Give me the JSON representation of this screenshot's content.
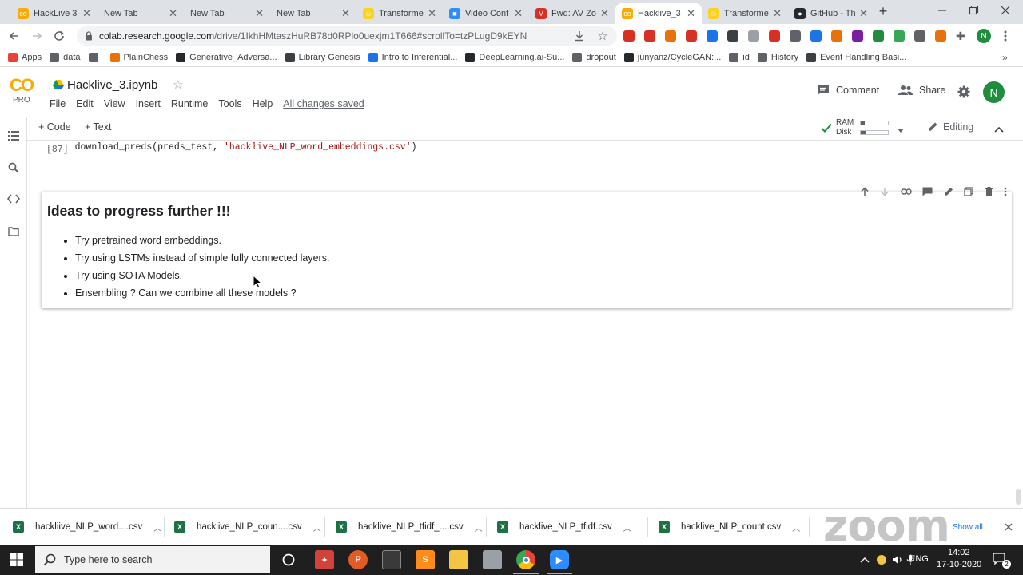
{
  "browser": {
    "tabs": [
      {
        "title": "HackLive 3",
        "fav_color": "#f9ab00",
        "fav_glyph": "co",
        "active": false
      },
      {
        "title": "New Tab",
        "fav_color": "",
        "fav_glyph": "",
        "active": false
      },
      {
        "title": "New Tab",
        "fav_color": "",
        "fav_glyph": "",
        "active": false
      },
      {
        "title": "New Tab",
        "fav_color": "",
        "fav_glyph": "",
        "active": false
      },
      {
        "title": "Transforme",
        "fav_color": "#ffd21e",
        "fav_glyph": "☺",
        "active": false
      },
      {
        "title": "Video Conf",
        "fav_color": "#2d8cff",
        "fav_glyph": "■",
        "active": false
      },
      {
        "title": "Fwd: AV Zo",
        "fav_color": "#d93025",
        "fav_glyph": "M",
        "active": false
      },
      {
        "title": "Hacklive_3",
        "fav_color": "#f9ab00",
        "fav_glyph": "co",
        "active": true
      },
      {
        "title": "Transforme",
        "fav_color": "#ffd21e",
        "fav_glyph": "☺",
        "active": false
      },
      {
        "title": "GitHub - Th",
        "fav_color": "#24292e",
        "fav_glyph": "●",
        "active": false
      }
    ],
    "url_host": "colab.research.google.com",
    "url_path": "/drive/1IkhHMtaszHuRB78d0RPlo0uexjm1T666#scrollTo=tzPLugD9kEYN",
    "extension_avatar": "N",
    "bookmarks": [
      {
        "label": "Apps",
        "color": "#ea4335"
      },
      {
        "label": "data",
        "color": "#5f6368"
      },
      {
        "label": "",
        "color": "#5f6368"
      },
      {
        "label": "PlainChess",
        "color": "#e8710a"
      },
      {
        "label": "Generative_Adversa...",
        "color": "#24292e"
      },
      {
        "label": "Library Genesis",
        "color": "#3c4043"
      },
      {
        "label": "Intro to Inferential...",
        "color": "#1a73e8"
      },
      {
        "label": "DeepLearning.ai-Su...",
        "color": "#24292e"
      },
      {
        "label": "dropout",
        "color": "#5f6368"
      },
      {
        "label": "junyanz/CycleGAN:...",
        "color": "#24292e"
      },
      {
        "label": "id",
        "color": "#5f6368"
      },
      {
        "label": "History",
        "color": "#5f6368"
      },
      {
        "label": "Event Handling Basi...",
        "color": "#3c4043"
      }
    ]
  },
  "colab": {
    "logo_text": "CO",
    "logo_sub": "PRO",
    "notebook_title": "Hacklive_3.ipynb",
    "menu": [
      "File",
      "Edit",
      "View",
      "Insert",
      "Runtime",
      "Tools",
      "Help"
    ],
    "saved_status": "All changes saved",
    "comment_label": "Comment",
    "share_label": "Share",
    "user_avatar": "N",
    "add_code_label": "+ Code",
    "add_text_label": "+ Text",
    "ram_label": "RAM",
    "disk_label": "Disk",
    "editing_label": "Editing"
  },
  "code_cell": {
    "exec_count": "[87]",
    "code_prefix": "download_preds(preds_test, ",
    "code_string": "'hacklive_NLP_word_embeddings.csv'",
    "code_suffix": ")"
  },
  "markdown_cell": {
    "heading": "Ideas to progress further !!!",
    "bullets": [
      "Try pretrained word embeddings.",
      "Try using LSTMs instead of simple fully connected layers.",
      "Try using SOTA Models.",
      "Ensembling ? Can we combine all these models ?"
    ]
  },
  "downloads": [
    "hackliive_NLP_word....csv",
    "hacklive_NLP_coun....csv",
    "hacklive_NLP_tfidf_....csv",
    "hacklive_NLP_tfidf.csv",
    "hacklive_NLP_count.csv"
  ],
  "downloads_show_all": "Show all",
  "zoom_watermark": "zoom",
  "taskbar": {
    "search_placeholder": "Type here to search",
    "language": "ENG",
    "time": "14:02",
    "date": "17-10-2020",
    "notification_count": "2"
  }
}
